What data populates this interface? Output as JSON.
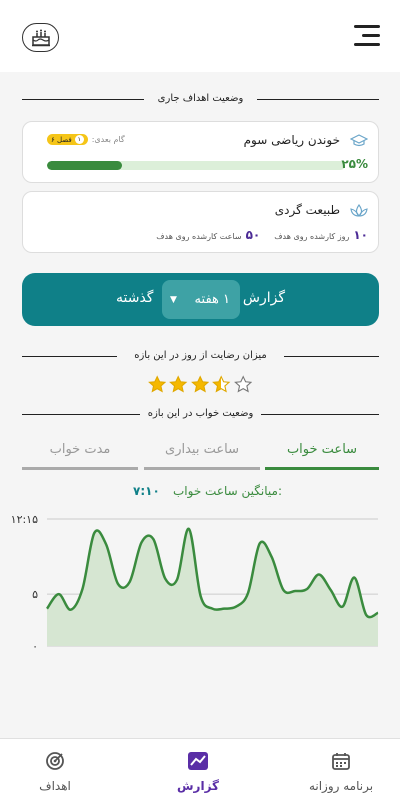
{
  "sections": {
    "current_goals": "وضعیت اهداف جاری",
    "satisfaction": "میزان رضایت از روز در این بازه",
    "sleep_status": "وضعیت خواب در این بازه"
  },
  "goals": [
    {
      "name": "خوندن ریاضی سوم",
      "icon": "graduation-cap-icon",
      "next_step_label": "گام بعدی:",
      "next_step_badge": "فصل ۶",
      "next_step_num": "۱",
      "progress_text": "۲۵%",
      "progress_value": 0.25
    },
    {
      "name": "طبیعت گردی",
      "icon": "lotus-icon",
      "days_value": "۱۰",
      "days_label": "روز کارشده روی هدف",
      "hours_value": "۵۰",
      "hours_label": "ساعت کارشده روی هدف"
    }
  ],
  "report": {
    "label": "گزارش",
    "period": "۱ هفته",
    "past": "گذشته"
  },
  "satisfaction_rating": 3.5,
  "sleep_tabs": [
    {
      "label": "ساعت خواب",
      "active": true
    },
    {
      "label": "ساعت بیداری",
      "active": false
    },
    {
      "label": "مدت خواب",
      "active": false
    }
  ],
  "average": {
    "label": "میانگین ساعت خواب:",
    "value": "۷:۱۰"
  },
  "chart_data": {
    "type": "area",
    "y_tick_labels": [
      "۱۲:۱۵",
      "۵",
      "۰"
    ],
    "series": [
      {
        "values": [
          3.6,
          5.0,
          3.5,
          5.5,
          10.9,
          9.8,
          6.0,
          6.2,
          10.0,
          10.3,
          6.5,
          6.4,
          11.3,
          4.8,
          3.6,
          3.6,
          3.8,
          5.1,
          9.9,
          8.6,
          5.4,
          5.3,
          5.5,
          6.9,
          5.4,
          3.8,
          6.6,
          3.0,
          3.2
        ]
      }
    ],
    "colors": {
      "line": "#3a8b3e",
      "fill": "#d6e6d2",
      "grid": "#cccccc"
    },
    "grid": true
  },
  "bottom_nav": [
    {
      "label": "برنامه روزانه",
      "icon": "calendar-icon",
      "active": false
    },
    {
      "label": "گزارش",
      "icon": "chart-icon",
      "active": true
    },
    {
      "label": "اهداف",
      "icon": "target-icon",
      "active": false
    }
  ]
}
